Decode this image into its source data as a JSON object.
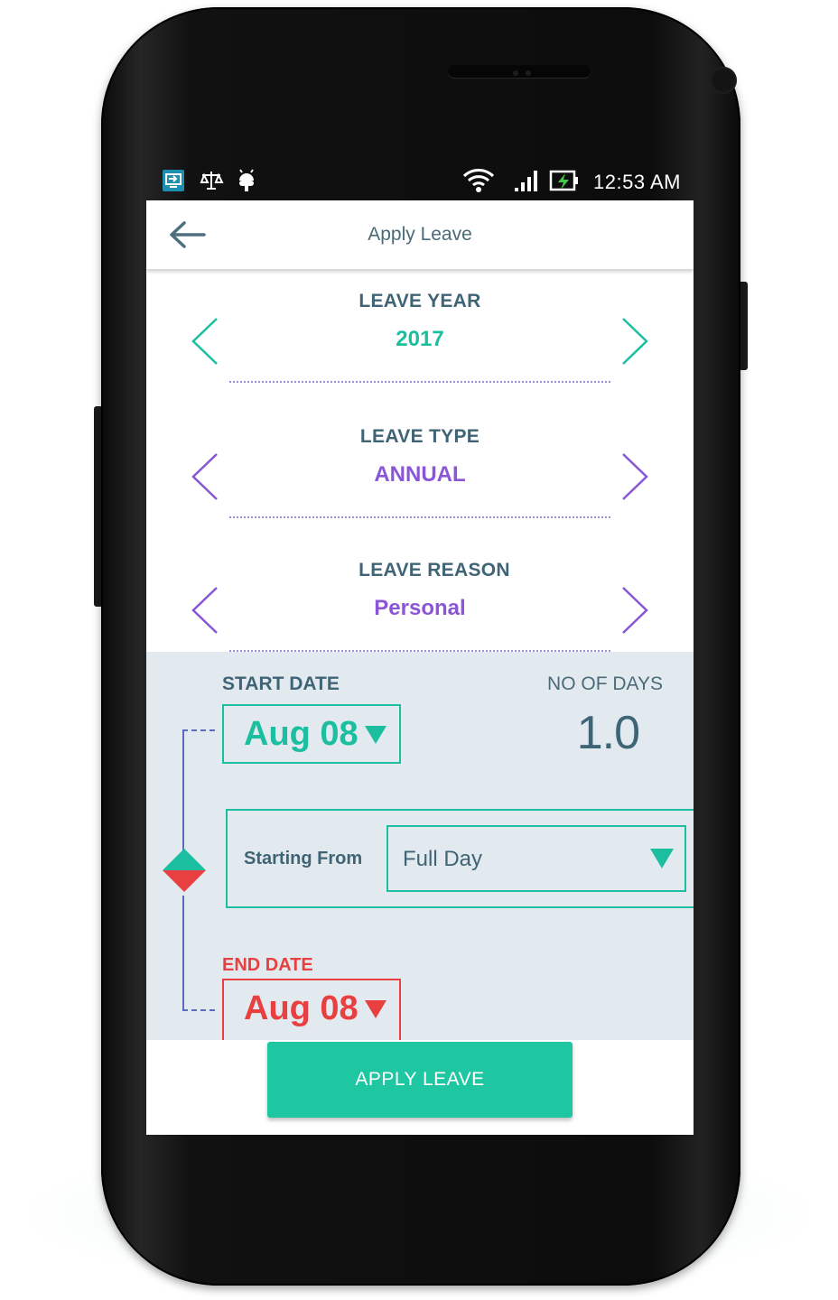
{
  "status_bar": {
    "time": "12:53 AM",
    "icons": [
      "screen-share-icon",
      "scale-icon",
      "android-debug-icon",
      "wifi-icon",
      "signal-icon",
      "battery-charging-icon"
    ]
  },
  "app_bar": {
    "title": "Apply Leave",
    "back_icon": "arrow-left-icon"
  },
  "leave_year": {
    "label": "LEAVE YEAR",
    "value": "2017",
    "color": "#1bbfa0"
  },
  "leave_type": {
    "label": "LEAVE TYPE",
    "value": "ANNUAL",
    "color": "#8a55d6"
  },
  "leave_reason": {
    "label": "LEAVE REASON",
    "value": "Personal",
    "color": "#8a55d6"
  },
  "start_date": {
    "label": "START DATE",
    "value": "Aug 08",
    "color": "#1bbfa0"
  },
  "no_of_days": {
    "label": "NO OF DAYS",
    "value": "1.0"
  },
  "starting_from": {
    "label": "Starting From",
    "selected": "Full Day"
  },
  "end_date": {
    "label": "END DATE",
    "value": "Aug 08",
    "color": "#e84040"
  },
  "apply_button": {
    "label": "APPLY LEAVE",
    "color": "#1ec6a2"
  }
}
